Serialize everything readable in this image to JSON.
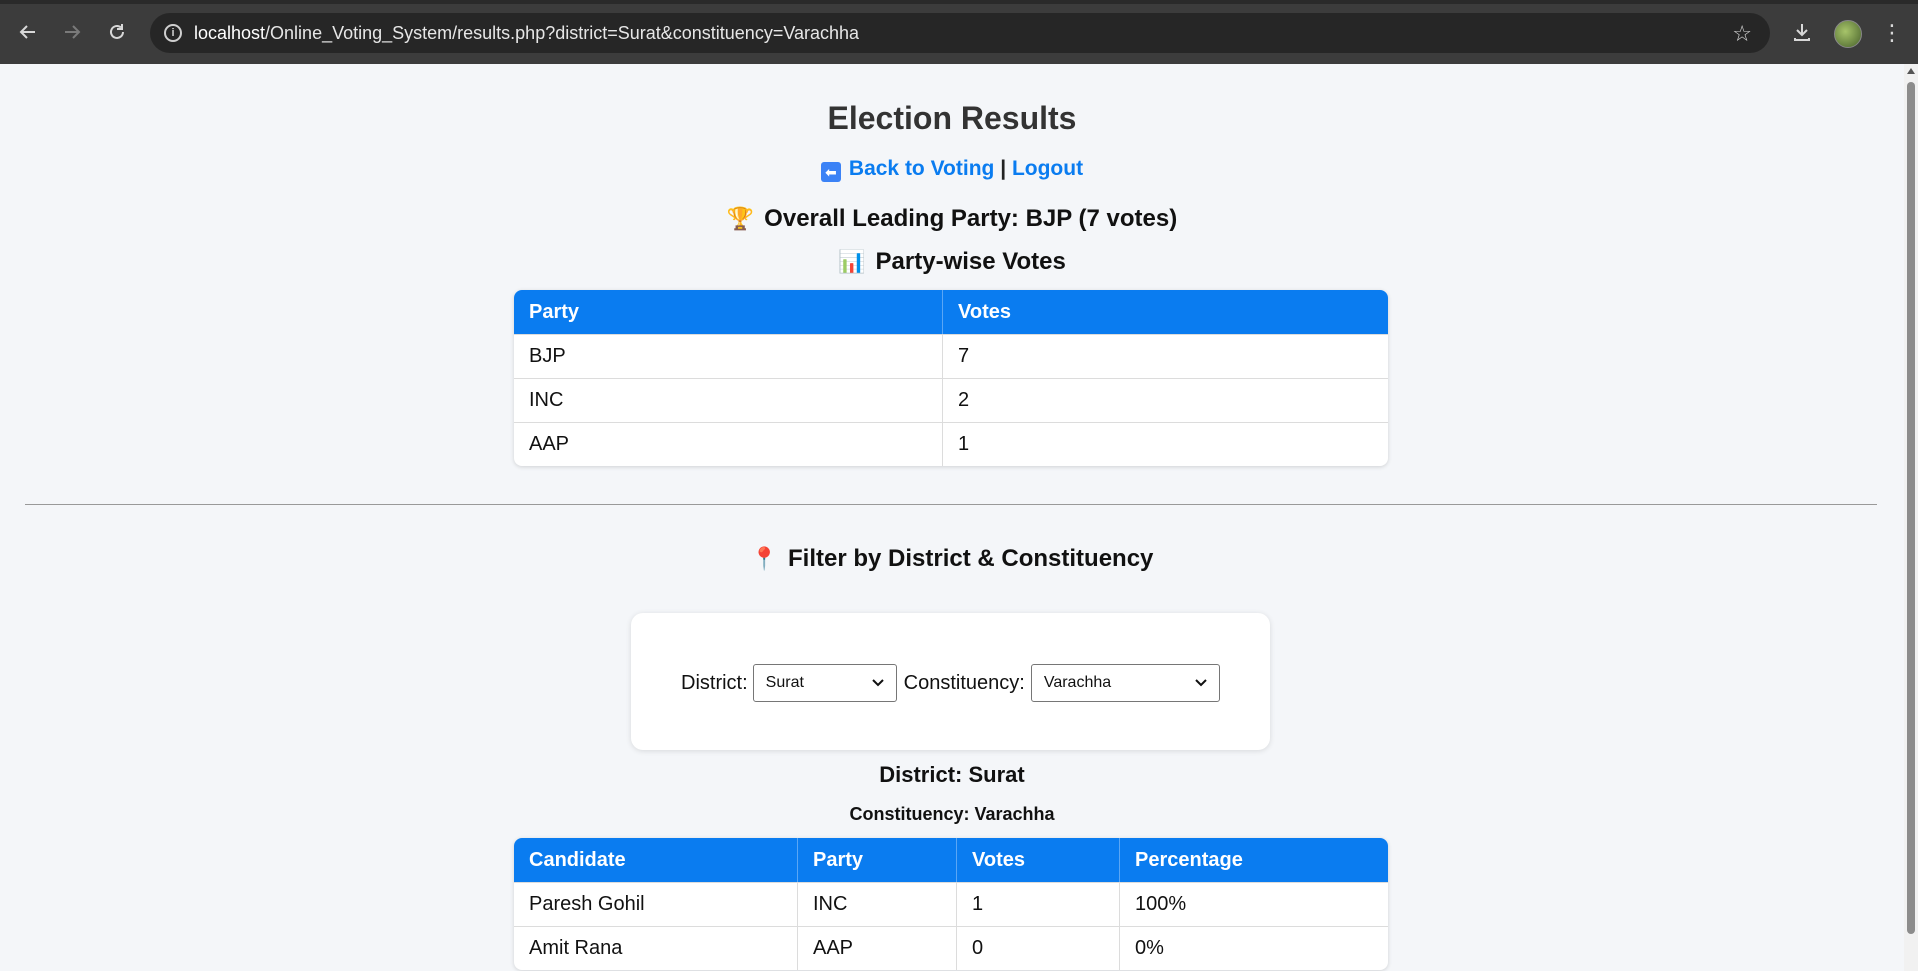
{
  "browser": {
    "url_host": "localhost",
    "url_path": "/Online_Voting_System/results.php?district=Surat&constituency=Varachha"
  },
  "page": {
    "title": "Election Results",
    "back_link": "Back to Voting",
    "separator": "|",
    "logout_link": "Logout",
    "leading_emoji": "🏆",
    "leading_text": "Overall Leading Party: BJP (7 votes)",
    "partywise_emoji": "📊",
    "partywise_heading": "Party-wise Votes",
    "party_table": {
      "headers": [
        "Party",
        "Votes"
      ],
      "rows": [
        [
          "BJP",
          "7"
        ],
        [
          "INC",
          "2"
        ],
        [
          "AAP",
          "1"
        ]
      ]
    },
    "filter_emoji": "📍",
    "filter_heading": "Filter by District & Constituency",
    "filter": {
      "district_label": "District:",
      "district_value": "Surat",
      "constituency_label": "Constituency:",
      "constituency_value": "Varachha"
    },
    "district_title": "District: Surat",
    "constituency_title": "Constituency: Varachha",
    "candidate_table": {
      "headers": [
        "Candidate",
        "Party",
        "Votes",
        "Percentage"
      ],
      "rows": [
        [
          "Paresh Gohil",
          "INC",
          "1",
          "100%"
        ],
        [
          "Amit Rana",
          "AAP",
          "0",
          "0%"
        ]
      ]
    }
  },
  "colors": {
    "accent": "#0a7cf0",
    "background": "#f4f6f9"
  }
}
